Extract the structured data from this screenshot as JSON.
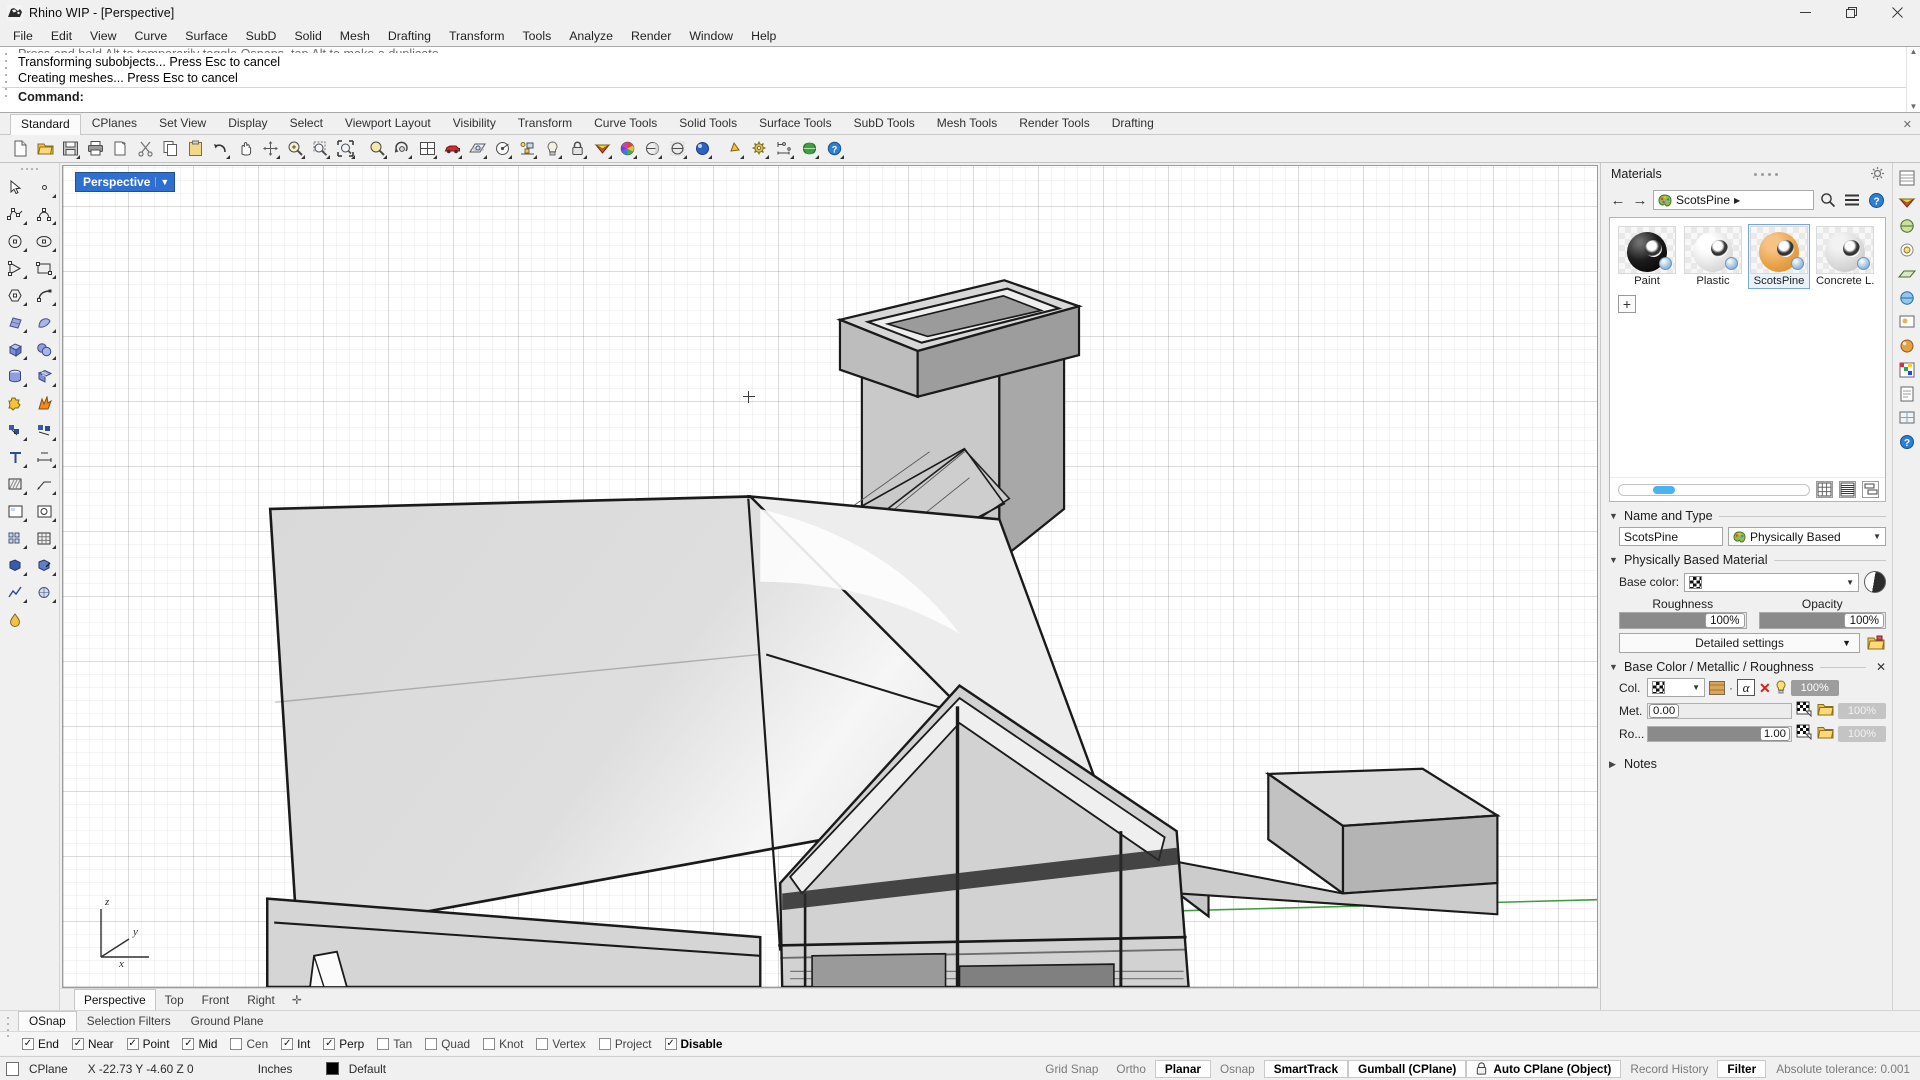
{
  "window": {
    "title": "Rhino WIP - [Perspective]",
    "app_icon": "rhino-logo-icon",
    "minimize_label": "Minimize",
    "maximize_label": "Maximize",
    "close_label": "Close"
  },
  "menubar": {
    "items": [
      "File",
      "Edit",
      "View",
      "Curve",
      "Surface",
      "SubD",
      "Solid",
      "Mesh",
      "Drafting",
      "Transform",
      "Tools",
      "Analyze",
      "Render",
      "Window",
      "Help"
    ]
  },
  "command_area": {
    "history": [
      "Press and hold Alt to temporarily toggle Osnaps, tap Alt to make a duplicate",
      "Transforming subobjects... Press Esc to cancel",
      "Creating meshes... Press Esc to cancel"
    ],
    "prompt_label": "Command:",
    "prompt_value": ""
  },
  "toolbar_tabs": {
    "active": "Standard",
    "items": [
      "Standard",
      "CPlanes",
      "Set View",
      "Display",
      "Select",
      "Viewport Layout",
      "Visibility",
      "Transform",
      "Curve Tools",
      "Solid Tools",
      "Surface Tools",
      "SubD Tools",
      "Mesh Tools",
      "Render Tools",
      "Drafting"
    ]
  },
  "icon_toolbar": {
    "buttons": [
      {
        "name": "new-file-icon",
        "tooltip": "New"
      },
      {
        "name": "open-file-icon",
        "tooltip": "Open"
      },
      {
        "name": "save-file-icon",
        "tooltip": "Save"
      },
      {
        "name": "print-icon",
        "tooltip": "Print"
      },
      {
        "name": "copy-to-clipboard-icon",
        "tooltip": "Copy to clipboard"
      },
      {
        "name": "cut-icon",
        "tooltip": "Cut"
      },
      {
        "name": "copy-icon",
        "tooltip": "Copy"
      },
      {
        "name": "paste-icon",
        "tooltip": "Paste"
      },
      {
        "name": "undo-icon",
        "tooltip": "Undo"
      },
      {
        "name": "pan-icon",
        "tooltip": "Pan"
      },
      {
        "name": "move-gumball-icon",
        "tooltip": "Move"
      },
      {
        "name": "zoom-in-icon",
        "tooltip": "Zoom in"
      },
      {
        "name": "zoom-window-icon",
        "tooltip": "Zoom window"
      },
      {
        "name": "zoom-extents-icon",
        "tooltip": "Zoom extents"
      },
      {
        "name": "zoom-selected-icon",
        "tooltip": "Zoom selected"
      },
      {
        "name": "rotate-view-icon",
        "tooltip": "Rotate view"
      },
      {
        "name": "four-viewport-icon",
        "tooltip": "4 viewports"
      },
      {
        "name": "render-car-icon",
        "tooltip": "Render"
      },
      {
        "name": "grid-settings-icon",
        "tooltip": "Grid options"
      },
      {
        "name": "properties-icon",
        "tooltip": "Object properties"
      },
      {
        "name": "object-select-icon",
        "tooltip": "Select objects"
      },
      {
        "name": "light-icon",
        "tooltip": "Create light"
      },
      {
        "name": "lock-icon",
        "tooltip": "Lock objects"
      },
      {
        "name": "layers-icon",
        "tooltip": "Layers"
      },
      {
        "name": "color-wheel-icon",
        "tooltip": "Display color"
      },
      {
        "name": "shaded-view-icon",
        "tooltip": "Shaded"
      },
      {
        "name": "ghosted-view-icon",
        "tooltip": "Ghosted"
      },
      {
        "name": "rendered-view-icon",
        "tooltip": "Rendered"
      },
      {
        "name": "cone-icon",
        "tooltip": "Cone"
      },
      {
        "name": "gears-icon",
        "tooltip": "Options"
      },
      {
        "name": "dimension-icon",
        "tooltip": "Dimension"
      },
      {
        "name": "globe-icon",
        "tooltip": "Web help"
      },
      {
        "name": "help-icon",
        "tooltip": "Help"
      }
    ]
  },
  "left_toolbar": {
    "buttons": [
      {
        "name": "select-arrow-icon"
      },
      {
        "name": "point-icon"
      },
      {
        "name": "polyline-icon"
      },
      {
        "name": "curve-icon"
      },
      {
        "name": "circle-icon"
      },
      {
        "name": "ellipse-icon"
      },
      {
        "name": "arc-icon"
      },
      {
        "name": "rectangle-icon"
      },
      {
        "name": "polygon-icon"
      },
      {
        "name": "curve-edit-icon"
      },
      {
        "name": "surface-from-curves-icon"
      },
      {
        "name": "revolve-surface-icon"
      },
      {
        "name": "box-icon"
      },
      {
        "name": "sphere-boolean-icon"
      },
      {
        "name": "cylinder-icon"
      },
      {
        "name": "subd-box-icon"
      },
      {
        "name": "boolean-union-icon"
      },
      {
        "name": "explode-icon"
      },
      {
        "name": "mesh-from-surface-icon"
      },
      {
        "name": "mesh-tools-icon"
      },
      {
        "name": "text-icon"
      },
      {
        "name": "dimension-linear-icon"
      },
      {
        "name": "hatch-icon"
      },
      {
        "name": "leader-icon"
      },
      {
        "name": "layout-icon"
      },
      {
        "name": "detail-icon"
      },
      {
        "name": "array-icon"
      },
      {
        "name": "grid-array-icon"
      },
      {
        "name": "block-icon"
      },
      {
        "name": "block-edit-icon"
      },
      {
        "name": "analyze-icon"
      },
      {
        "name": "render-mesh-icon"
      },
      {
        "name": "material-drop-icon"
      }
    ]
  },
  "viewport": {
    "label": "Perspective",
    "label_caret": "caret-down-icon",
    "axis": {
      "z": "z",
      "y": "y",
      "x": "x"
    },
    "tabs": {
      "active": "Perspective",
      "items": [
        "Perspective",
        "Top",
        "Front",
        "Right"
      ],
      "add_label": "+"
    }
  },
  "materials_panel": {
    "title": "Materials",
    "gear_icon": "gear-icon",
    "nav": {
      "back_icon": "arrow-left-icon",
      "forward_icon": "arrow-right-icon",
      "current_material": "ScotsPine",
      "material_icon": "material-palette-icon",
      "caret_icon": "caret-right-icon",
      "search_icon": "search-icon",
      "list_icon": "list-menu-icon",
      "help_icon": "help-circle-icon"
    },
    "swatches": [
      {
        "label": "Paint",
        "color": "#161616",
        "selected": false
      },
      {
        "label": "Plastic",
        "color": "#e8e8e8",
        "selected": false
      },
      {
        "label": "ScotsPine",
        "color": "#e8a044",
        "selected": true
      },
      {
        "label": "Concrete L...",
        "color": "#dcdcdc",
        "selected": false
      }
    ],
    "add_button": "+",
    "size_slider_value": 22,
    "view_buttons": [
      "grid-view-icon",
      "list-view-icon",
      "detail-view-icon"
    ],
    "sections": {
      "name_and_type": {
        "title": "Name and Type",
        "name_value": "ScotsPine",
        "type_value": "Physically Based",
        "type_icon": "material-palette-icon",
        "caret_icon": "caret-down-icon"
      },
      "physically_based": {
        "title": "Physically Based Material",
        "base_color_label": "Base color:",
        "base_color_swatch": "checker-transparent",
        "preview_icon": "sphere-preview-icon",
        "roughness_label": "Roughness",
        "roughness_value": "100%",
        "roughness_fill": 80,
        "opacity_label": "Opacity",
        "opacity_value": "100%",
        "opacity_fill": 80,
        "detailed_settings_label": "Detailed settings",
        "detailed_caret": "caret-down-icon",
        "folder_icon": "open-folder-icon"
      },
      "texture": {
        "title": "Base Color /  Metallic / Roughness",
        "close_icon": "close-icon",
        "rows": [
          {
            "label": "Col.",
            "swatch": "checker-transparent",
            "caret": "caret-down-icon",
            "texture_icon": "wood-texture-icon",
            "alpha_icon": "alpha-channel-icon",
            "delete_icon": "remove-texture-icon",
            "bulb_icon": "lightbulb-icon",
            "amount": "100%",
            "amount_dim": false
          },
          {
            "label": "Met.",
            "value": "0.00",
            "fill": 0,
            "checker_icon": "checker-texture-icon",
            "folder_icon": "open-folder-icon",
            "amount": "100%",
            "amount_dim": true
          },
          {
            "label": "Ro...",
            "value": "1.00",
            "fill": 84,
            "checker_icon": "checker-texture-icon",
            "folder_icon": "open-folder-icon",
            "amount": "100%",
            "amount_dim": true
          }
        ]
      },
      "notes": {
        "title": "Notes"
      }
    }
  },
  "right_edge_toolbar": {
    "buttons": [
      {
        "name": "properties-panel-icon"
      },
      {
        "name": "layers-panel-icon"
      },
      {
        "name": "display-panel-icon"
      },
      {
        "name": "light-panel-icon"
      },
      {
        "name": "ground-plane-panel-icon"
      },
      {
        "name": "environment-panel-icon"
      },
      {
        "name": "render-panel-icon"
      },
      {
        "name": "material-panel-icon"
      },
      {
        "name": "texture-panel-icon"
      },
      {
        "name": "notes-panel-icon"
      },
      {
        "name": "named-views-panel-icon"
      },
      {
        "name": "help-panel-icon"
      }
    ]
  },
  "osnap": {
    "tabs": {
      "active": "OSnap",
      "items": [
        "OSnap",
        "Selection Filters",
        "Ground Plane"
      ]
    },
    "checkboxes": [
      {
        "label": "End",
        "checked": true
      },
      {
        "label": "Near",
        "checked": true
      },
      {
        "label": "Point",
        "checked": true
      },
      {
        "label": "Mid",
        "checked": true
      },
      {
        "label": "Cen",
        "checked": false
      },
      {
        "label": "Int",
        "checked": true
      },
      {
        "label": "Perp",
        "checked": true
      },
      {
        "label": "Tan",
        "checked": false
      },
      {
        "label": "Quad",
        "checked": false
      },
      {
        "label": "Knot",
        "checked": false
      },
      {
        "label": "Vertex",
        "checked": false
      },
      {
        "label": "Project",
        "checked": false
      },
      {
        "label": "Disable",
        "checked": true,
        "bold": true
      }
    ]
  },
  "statusbar": {
    "cplane_icon": "cplane-icon",
    "cplane_label": "CPlane",
    "coords": "X -22.73  Y -4.60  Z 0",
    "units": "Inches",
    "layer_swatch": "#000000",
    "layer_name": "Default",
    "toggles": [
      {
        "label": "Grid Snap",
        "on": false,
        "dim": true
      },
      {
        "label": "Ortho",
        "on": false,
        "dim": true
      },
      {
        "label": "Planar",
        "on": true
      },
      {
        "label": "Osnap",
        "on": false,
        "dim": true
      },
      {
        "label": "SmartTrack",
        "on": true
      },
      {
        "label": "Gumball (CPlane)",
        "on": true
      },
      {
        "label": "Auto CPlane (Object)",
        "on": true,
        "lock_icon": "lock-icon"
      },
      {
        "label": "Record History",
        "on": false,
        "dim": true
      },
      {
        "label": "Filter",
        "on": true
      }
    ],
    "tolerance": "Absolute tolerance: 0.001"
  },
  "colors": {
    "accent": "#2f6fd0",
    "panel_bg": "#f0f0f0",
    "viewport_bg": "#ffffff",
    "material_orange": "#e8a044",
    "green_axis": "#3f9c3f"
  }
}
